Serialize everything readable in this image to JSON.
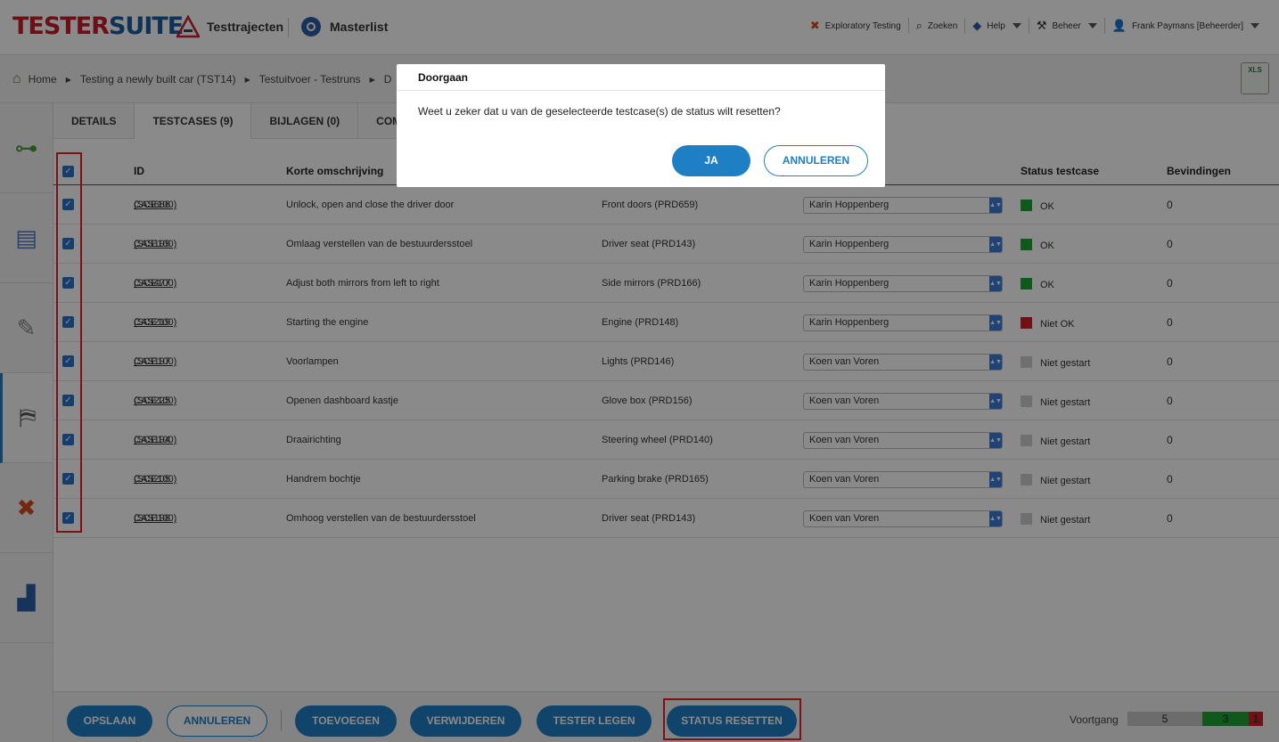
{
  "header": {
    "logo_part1": "TESTER",
    "logo_part2": "SUITE",
    "nav": [
      {
        "label": "Testtrajecten",
        "icon": "warning-cone-icon"
      },
      {
        "label": "Masterlist",
        "icon": "globe-icon"
      }
    ],
    "right": [
      {
        "label": "Exploratory Testing",
        "icon": "cross-icon"
      },
      {
        "label": "Zoeken",
        "icon": "search-icon"
      },
      {
        "label": "Help",
        "icon": "help-icon"
      },
      {
        "label": "Beheer",
        "icon": "tools-icon"
      },
      {
        "label": "Frank Paymans [Beheerder]",
        "icon": "user-avatar-icon"
      }
    ]
  },
  "breadcrumb": {
    "items": [
      "Home",
      "Testing a newly built car (TST14)",
      "Testuitvoer - Testruns",
      "D"
    ]
  },
  "export_icon": "XLS",
  "tabs": [
    "DETAILS",
    "TESTCASES (9)",
    "BIJLAGEN (0)",
    "COM"
  ],
  "table": {
    "headers": {
      "id": "ID",
      "desc": "Korte omschrijving",
      "status": "Status testcase",
      "findings": "Bevindingen"
    },
    "rows": [
      {
        "id": "CAS686",
        "sce": "(SCE100)",
        "desc": "Unlock, open and close the driver door",
        "object": "Front doors (PRD659)",
        "tester": "Karin Hoppenberg",
        "status": "OK",
        "color": "#21a336",
        "findings": "0"
      },
      {
        "id": "CAS199",
        "sce": "(SCE100)",
        "desc": "Omlaag verstellen van de bestuurdersstoel",
        "object": "Driver seat (PRD143)",
        "tester": "Karin Hoppenberg",
        "status": "OK",
        "color": "#21a336",
        "findings": "0"
      },
      {
        "id": "CAS477",
        "sce": "(SCE100)",
        "desc": "Adjust both mirrors from left to right",
        "object": "Side mirrors (PRD166)",
        "tester": "Karin Hoppenberg",
        "status": "OK",
        "color": "#21a336",
        "findings": "0"
      },
      {
        "id": "CAS219",
        "sce": "(SCE100)",
        "desc": "Starting the engine",
        "object": "Engine (PRD148)",
        "tester": "Karin Hoppenberg",
        "status": "Niet OK",
        "color": "#d0202e",
        "findings": "0"
      },
      {
        "id": "CAS197",
        "sce": "(SCE100)",
        "desc": "Voorlampen",
        "object": "Lights (PRD146)",
        "tester": "Koen van Voren",
        "status": "Niet gestart",
        "color": "#cfcfcf",
        "findings": "0"
      },
      {
        "id": "CAS225",
        "sce": "(SCE100)",
        "desc": "Openen dashboard kastje",
        "object": "Glove box (PRD156)",
        "tester": "Koen van Voren",
        "status": "Niet gestart",
        "color": "#cfcfcf",
        "findings": "0"
      },
      {
        "id": "CAS194",
        "sce": "(SCE100)",
        "desc": "Draairichting",
        "object": "Steering wheel (PRD140)",
        "tester": "Koen van Voren",
        "status": "Niet gestart",
        "color": "#cfcfcf",
        "findings": "0"
      },
      {
        "id": "CAS205",
        "sce": "(SCE100)",
        "desc": "Handrem bochtje",
        "object": "Parking brake (PRD165)",
        "tester": "Koen van Voren",
        "status": "Niet gestart",
        "color": "#cfcfcf",
        "findings": "0"
      },
      {
        "id": "CAS198",
        "sce": "(SCE100)",
        "desc": "Omhoog verstellen van de bestuurdersstoel",
        "object": "Driver seat (PRD143)",
        "tester": "Koen van Voren",
        "status": "Niet gestart",
        "color": "#cfcfcf",
        "findings": "0"
      }
    ]
  },
  "bottom": {
    "opslaan": "OPSLAAN",
    "annuleren": "ANNULEREN",
    "toevoegen": "TOEVOEGEN",
    "verwijderen": "VERWIJDEREN",
    "tester_legen": "TESTER LEGEN",
    "status_resetten": "STATUS RESETTEN",
    "voortgang_label": "Voortgang",
    "voortgang": [
      {
        "value": "5",
        "color": "#c8c8c8"
      },
      {
        "value": "3",
        "color": "#21a336"
      },
      {
        "value": "1",
        "color": "#d0202e"
      }
    ]
  },
  "modal": {
    "title": "Doorgaan",
    "message": "Weet u zeker dat u van de geselecteerde testcase(s) de status wilt resetten?",
    "yes": "JA",
    "cancel": "ANNULEREN"
  },
  "colors": {
    "accent": "#1e7fc5",
    "highlight": "#e8212a"
  }
}
